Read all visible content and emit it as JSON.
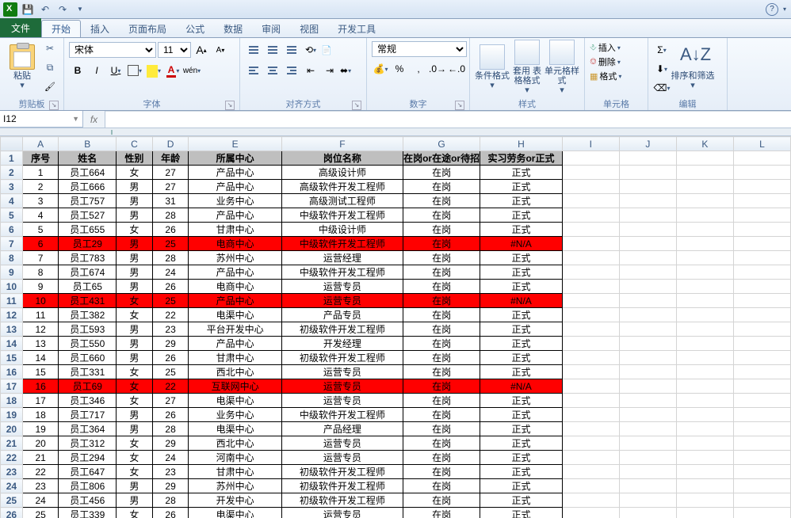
{
  "titlebar": {
    "help": "?"
  },
  "tabs": {
    "file": "文件",
    "items": [
      "开始",
      "插入",
      "页面布局",
      "公式",
      "数据",
      "审阅",
      "视图",
      "开发工具"
    ],
    "active": 0
  },
  "ribbon": {
    "clipboard": {
      "paste": "粘贴",
      "label": "剪贴板"
    },
    "font": {
      "family": "宋体",
      "size": "11",
      "label": "字体",
      "grow": "A",
      "shrink": "A"
    },
    "align": {
      "label": "对齐方式",
      "wrap": "自动换行",
      "merge": "合并后居中"
    },
    "number": {
      "format": "常规",
      "label": "数字"
    },
    "styles": {
      "cond": "条件格式",
      "table": "套用\n表格格式",
      "cell": "单元格样式",
      "label": "样式"
    },
    "cells": {
      "insert": "插入",
      "delete": "删除",
      "format": "格式",
      "label": "单元格"
    },
    "editing": {
      "sort": "排序和筛选",
      "label": "编辑"
    }
  },
  "nameBox": "I12",
  "formula": "",
  "cols": [
    "A",
    "B",
    "C",
    "D",
    "E",
    "F",
    "G",
    "H",
    "I",
    "J",
    "K",
    "L"
  ],
  "headers": [
    "序号",
    "姓名",
    "性别",
    "年龄",
    "所属中心",
    "岗位名称",
    "在岗or在途or待招",
    "实习劳务or正式"
  ],
  "rows": [
    {
      "n": 1,
      "r": false,
      "d": [
        "1",
        "员工664",
        "女",
        "27",
        "产品中心",
        "高级设计师",
        "在岗",
        "正式"
      ]
    },
    {
      "n": 2,
      "r": false,
      "d": [
        "2",
        "员工666",
        "男",
        "27",
        "产品中心",
        "高级软件开发工程师",
        "在岗",
        "正式"
      ]
    },
    {
      "n": 3,
      "r": false,
      "d": [
        "3",
        "员工757",
        "男",
        "31",
        "业务中心",
        "高级测试工程师",
        "在岗",
        "正式"
      ]
    },
    {
      "n": 4,
      "r": false,
      "d": [
        "4",
        "员工527",
        "男",
        "28",
        "产品中心",
        "中级软件开发工程师",
        "在岗",
        "正式"
      ]
    },
    {
      "n": 5,
      "r": false,
      "d": [
        "5",
        "员工655",
        "女",
        "26",
        "甘肃中心",
        "中级设计师",
        "在岗",
        "正式"
      ]
    },
    {
      "n": 6,
      "r": true,
      "d": [
        "6",
        "员工29",
        "男",
        "25",
        "电商中心",
        "中级软件开发工程师",
        "在岗",
        "#N/A"
      ]
    },
    {
      "n": 7,
      "r": false,
      "d": [
        "7",
        "员工783",
        "男",
        "28",
        "苏州中心",
        "运营经理",
        "在岗",
        "正式"
      ]
    },
    {
      "n": 8,
      "r": false,
      "d": [
        "8",
        "员工674",
        "男",
        "24",
        "产品中心",
        "中级软件开发工程师",
        "在岗",
        "正式"
      ]
    },
    {
      "n": 9,
      "r": false,
      "d": [
        "9",
        "员工65",
        "男",
        "26",
        "电商中心",
        "运营专员",
        "在岗",
        "正式"
      ]
    },
    {
      "n": 10,
      "r": true,
      "d": [
        "10",
        "员工431",
        "女",
        "25",
        "产品中心",
        "运营专员",
        "在岗",
        "#N/A"
      ]
    },
    {
      "n": 11,
      "r": false,
      "d": [
        "11",
        "员工382",
        "女",
        "22",
        "电渠中心",
        "产品专员",
        "在岗",
        "正式"
      ]
    },
    {
      "n": 12,
      "r": false,
      "d": [
        "12",
        "员工593",
        "男",
        "23",
        "平台开发中心",
        "初级软件开发工程师",
        "在岗",
        "正式"
      ]
    },
    {
      "n": 13,
      "r": false,
      "d": [
        "13",
        "员工550",
        "男",
        "29",
        "产品中心",
        "开发经理",
        "在岗",
        "正式"
      ]
    },
    {
      "n": 14,
      "r": false,
      "d": [
        "14",
        "员工660",
        "男",
        "26",
        "甘肃中心",
        "初级软件开发工程师",
        "在岗",
        "正式"
      ]
    },
    {
      "n": 15,
      "r": false,
      "d": [
        "15",
        "员工331",
        "女",
        "25",
        "西北中心",
        "运营专员",
        "在岗",
        "正式"
      ]
    },
    {
      "n": 16,
      "r": true,
      "d": [
        "16",
        "员工69",
        "女",
        "22",
        "互联网中心",
        "运营专员",
        "在岗",
        "#N/A"
      ]
    },
    {
      "n": 17,
      "r": false,
      "d": [
        "17",
        "员工346",
        "女",
        "27",
        "电渠中心",
        "运营专员",
        "在岗",
        "正式"
      ]
    },
    {
      "n": 18,
      "r": false,
      "d": [
        "18",
        "员工717",
        "男",
        "26",
        "业务中心",
        "中级软件开发工程师",
        "在岗",
        "正式"
      ]
    },
    {
      "n": 19,
      "r": false,
      "d": [
        "19",
        "员工364",
        "男",
        "28",
        "电渠中心",
        "产品经理",
        "在岗",
        "正式"
      ]
    },
    {
      "n": 20,
      "r": false,
      "d": [
        "20",
        "员工312",
        "女",
        "29",
        "西北中心",
        "运营专员",
        "在岗",
        "正式"
      ]
    },
    {
      "n": 21,
      "r": false,
      "d": [
        "21",
        "员工294",
        "女",
        "24",
        "河南中心",
        "运营专员",
        "在岗",
        "正式"
      ]
    },
    {
      "n": 22,
      "r": false,
      "d": [
        "22",
        "员工647",
        "女",
        "23",
        "甘肃中心",
        "初级软件开发工程师",
        "在岗",
        "正式"
      ]
    },
    {
      "n": 23,
      "r": false,
      "d": [
        "23",
        "员工806",
        "男",
        "29",
        "苏州中心",
        "初级软件开发工程师",
        "在岗",
        "正式"
      ]
    },
    {
      "n": 24,
      "r": false,
      "d": [
        "24",
        "员工456",
        "男",
        "28",
        "开发中心",
        "初级软件开发工程师",
        "在岗",
        "正式"
      ]
    },
    {
      "n": 25,
      "r": false,
      "d": [
        "25",
        "员工339",
        "女",
        "26",
        "电渠中心",
        "运营专员",
        "在岗",
        "正式"
      ]
    }
  ]
}
